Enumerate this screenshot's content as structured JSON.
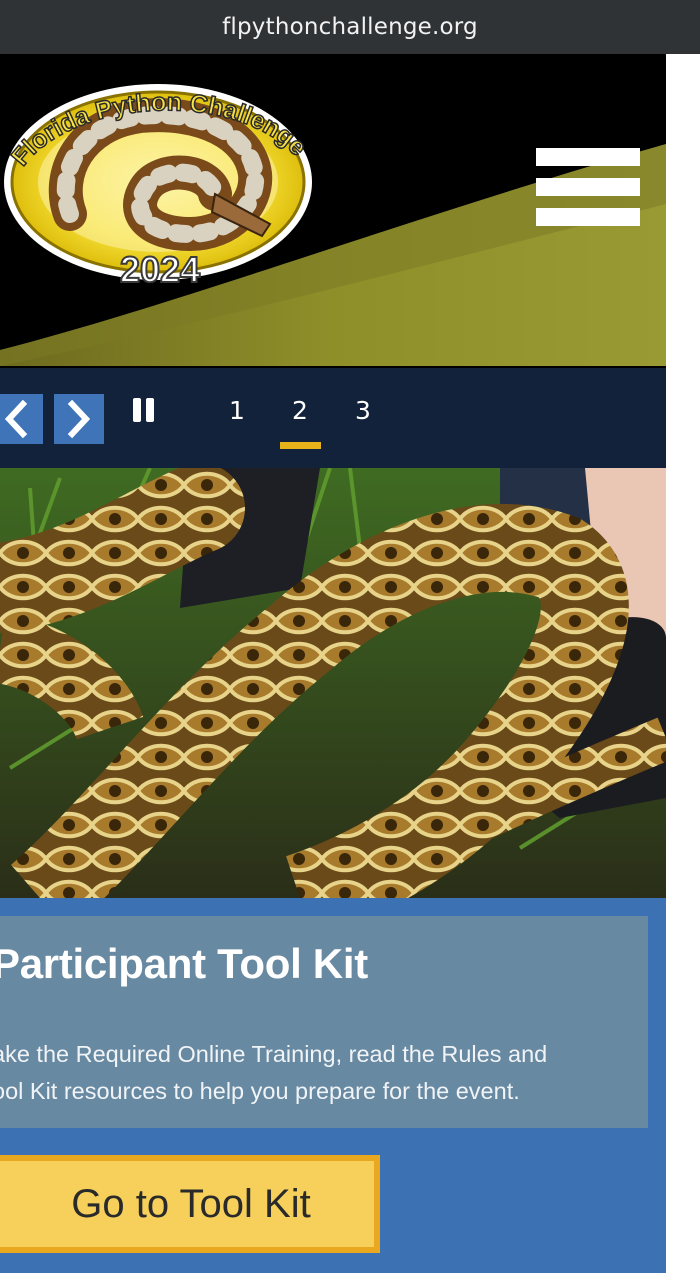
{
  "browser": {
    "url": "flpythonchallenge.org"
  },
  "header": {
    "logo_top_text": "Florida Python Challenge",
    "logo_year": "2024",
    "menu_icon": "hamburger-menu-icon"
  },
  "slider": {
    "prev_icon": "chevron-left-icon",
    "next_icon": "chevron-right-icon",
    "pause_icon": "pause-icon",
    "pages": [
      "1",
      "2",
      "3"
    ],
    "active_page": "2"
  },
  "card": {
    "title": "Participant Tool Kit",
    "body_line1": "ake the Required Online Training, read the Rules and",
    "body_line2": "ool Kit resources to help you prepare for the event."
  },
  "cta": {
    "label": "Go to Tool Kit"
  },
  "colors": {
    "header_bg": "#000000",
    "header_swoosh": "#8f8f2a",
    "slider_bg": "#12223a",
    "arrow_button": "#3f74b8",
    "active_underline": "#e8b21a",
    "page_blue": "#3c72b4",
    "card_bg": "#6889a2",
    "cta_bg": "#f6d05a",
    "cta_border": "#e9a820"
  }
}
